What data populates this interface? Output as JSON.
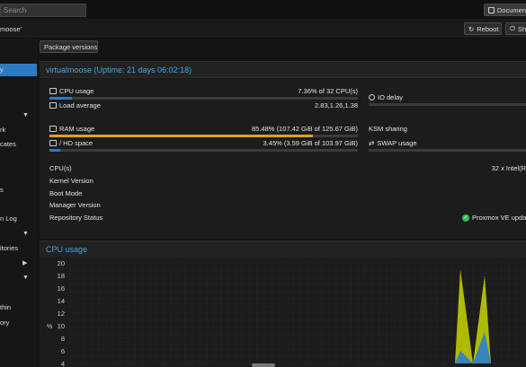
{
  "topbar": {
    "search_placeholder": "Search",
    "docs_label": "Documen"
  },
  "subbar": {
    "breadcrumb": "moose'",
    "reboot_label": "Reboot",
    "shell_label": "Sh"
  },
  "toolbar": {
    "package_versions_label": "Package versions"
  },
  "tree": {
    "items": [
      {
        "label": "y",
        "selected": true
      },
      {
        "label": "",
        "chevron": "chevron-down"
      },
      {
        "label": "rk"
      },
      {
        "label": "cates"
      },
      {
        "label": "s"
      },
      {
        "label": "n Log"
      },
      {
        "label": "",
        "chevron": "chevron-down"
      },
      {
        "label": "itories"
      },
      {
        "label": "",
        "chevron": "chevron-right"
      },
      {
        "label": "",
        "chevron": "chevron-down"
      },
      {
        "label": "thin"
      },
      {
        "label": "ory"
      }
    ]
  },
  "status": {
    "title": "virtualmoose (Uptime: 21 days 06:02:18)",
    "cpu_label": "CPU usage",
    "cpu_value": "7.36% of 32 CPU(s)",
    "cpu_fraction": 0.0736,
    "load_label": "Load average",
    "load_value": "2.83,1.26,1.38",
    "io_label": "IO delay",
    "io_fraction": 0.0,
    "ram_label": "RAM usage",
    "ram_value": "85.48% (107.42 GiB of 125.67 GiB)",
    "ram_fraction": 0.8548,
    "ksm_label": "KSM sharing",
    "hd_label": "/ HD space",
    "hd_value": "3.45% (3.59 GiB of 103.97 GiB)",
    "hd_fraction": 0.0345,
    "swap_label": "SWAP usage",
    "cpus_label": "CPU(s)",
    "cpus_value": "32 x Intel(R",
    "kernel_label": "Kernel Version",
    "boot_label": "Boot Mode",
    "manager_label": "Manager Version",
    "repo_label": "Repository Status",
    "repo_value": "Proxmox VE upda"
  },
  "cpu_chart": {
    "title": "CPU usage",
    "chart_data": {
      "type": "area",
      "yticks": [
        "20",
        "18",
        "16",
        "14",
        "12",
        "10",
        "8",
        "6",
        "4"
      ],
      "ylim": [
        4,
        20
      ],
      "ylabel": "%",
      "series": [
        {
          "color": "#c9d600",
          "values": [
            0,
            0,
            19,
            4,
            18,
            0
          ]
        },
        {
          "color": "#2a7fd0",
          "values": [
            0,
            0,
            6,
            4,
            9,
            0
          ]
        }
      ]
    },
    "colors": {
      "grid": "#333333",
      "axis_text": "#cfcfcf"
    }
  }
}
